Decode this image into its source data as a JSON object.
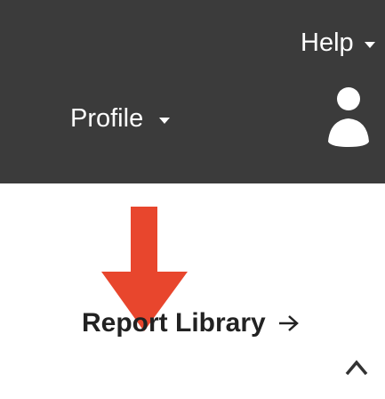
{
  "topbar": {
    "bg_color": "#3b3b3b",
    "help_label": "Help",
    "help_icon": "caret-down-icon",
    "profile_label": "Profile",
    "profile_icon": "caret-down-icon",
    "avatar_icon": "user-icon"
  },
  "annotation": {
    "arrow_icon": "arrow-down-icon",
    "arrow_color": "#e8462d"
  },
  "content": {
    "report_library_label": "Report Library",
    "report_library_icon": "chevron-right-icon",
    "collapse_icon": "chevron-up-icon"
  }
}
